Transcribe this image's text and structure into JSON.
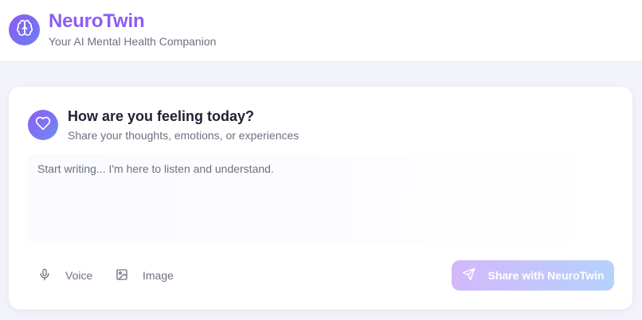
{
  "header": {
    "title": "NeuroTwin",
    "subtitle": "Your AI Mental Health Companion",
    "logo_icon": "brain-icon"
  },
  "card": {
    "title": "How are you feeling today?",
    "subtitle": "Share your thoughts, emotions, or experiences",
    "icon": "heart-icon",
    "input": {
      "value": "",
      "placeholder": "Start writing... I'm here to listen and understand."
    },
    "actions": {
      "voice_label": "Voice",
      "voice_icon": "microphone-icon",
      "image_label": "Image",
      "image_icon": "image-icon"
    },
    "share": {
      "label": "Share with NeuroTwin",
      "icon": "send-icon",
      "state": "disabled"
    }
  },
  "colors": {
    "accent": "#8b5cf6",
    "accent_secondary": "#6d7cf0",
    "text_primary": "#1f2233",
    "text_muted": "#6b7280",
    "background": "#f3f4fb"
  }
}
